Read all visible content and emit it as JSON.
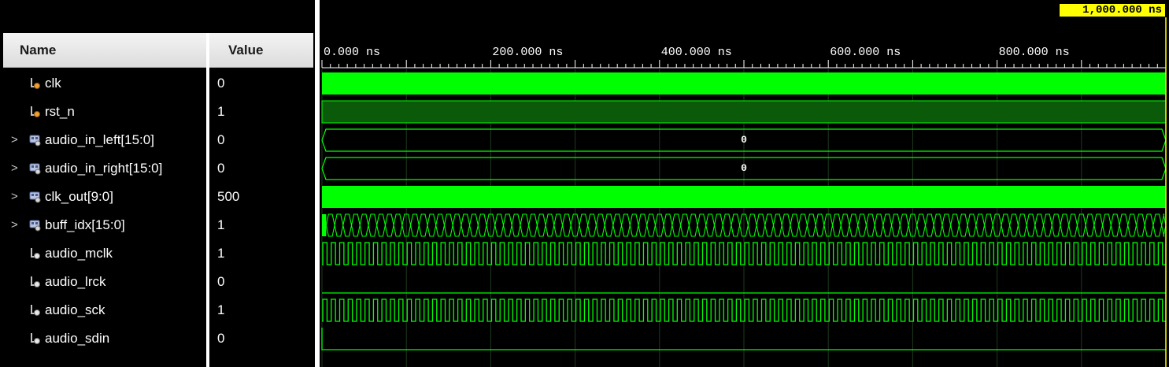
{
  "columns": {
    "name": "Name",
    "value": "Value"
  },
  "cursor": {
    "time_label": "1,000.000 ns"
  },
  "timeline": {
    "unit": "ns",
    "range_ns": [
      0,
      1000
    ],
    "ticks": [
      {
        "ns": 0,
        "label": "0.000 ns"
      },
      {
        "ns": 200,
        "label": "200.000 ns"
      },
      {
        "ns": 400,
        "label": "400.000 ns"
      },
      {
        "ns": 600,
        "label": "600.000 ns"
      },
      {
        "ns": 800,
        "label": "800.000 ns"
      }
    ]
  },
  "colors": {
    "wave_green": "#00ff00",
    "dark_green": "#0a5a0a",
    "grid": "#1e3a1e",
    "cursor_bg": "#ffff00"
  },
  "signals": [
    {
      "name": "clk",
      "value": "0",
      "kind": "input",
      "expandable": false,
      "wave": "dense-clock",
      "icon": "input-pin-icon"
    },
    {
      "name": "rst_n",
      "value": "1",
      "kind": "input",
      "expandable": false,
      "wave": "high-steady",
      "icon": "input-pin-icon"
    },
    {
      "name": "audio_in_left[15:0]",
      "value": "0",
      "kind": "bus",
      "expandable": true,
      "wave": "bus-constant",
      "bus_label": "0",
      "icon": "bus-icon"
    },
    {
      "name": "audio_in_right[15:0]",
      "value": "0",
      "kind": "bus",
      "expandable": true,
      "wave": "bus-constant",
      "bus_label": "0",
      "icon": "bus-icon"
    },
    {
      "name": "clk_out[9:0]",
      "value": "500",
      "kind": "bus",
      "expandable": true,
      "wave": "bus-dense",
      "icon": "bus-icon"
    },
    {
      "name": "buff_idx[15:0]",
      "value": "1",
      "kind": "bus",
      "expandable": true,
      "wave": "bus-toggling",
      "icon": "bus-icon"
    },
    {
      "name": "audio_mclk",
      "value": "1",
      "kind": "output",
      "expandable": false,
      "wave": "pulse-train",
      "icon": "output-pin-icon"
    },
    {
      "name": "audio_lrck",
      "value": "0",
      "kind": "output",
      "expandable": false,
      "wave": "low",
      "icon": "output-pin-icon"
    },
    {
      "name": "audio_sck",
      "value": "1",
      "kind": "output",
      "expandable": false,
      "wave": "pulse-train",
      "icon": "output-pin-icon"
    },
    {
      "name": "audio_sdin",
      "value": "0",
      "kind": "output",
      "expandable": false,
      "wave": "low-with-start-edge",
      "icon": "output-pin-icon"
    }
  ]
}
